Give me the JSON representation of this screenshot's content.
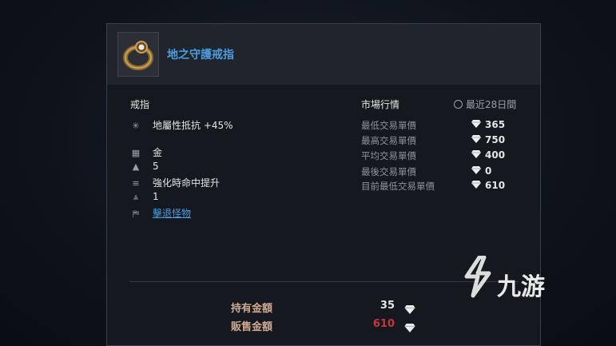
{
  "item": {
    "name": "地之守護戒指",
    "category": "戒指",
    "stats": [
      {
        "icon": "sparkle-icon",
        "text": "地屬性抵抗 +45%"
      },
      {
        "icon": "grade-icon",
        "text": "金"
      },
      {
        "icon": "level-icon",
        "text": "5"
      },
      {
        "icon": "list-icon",
        "text": "強化時命中提升"
      },
      {
        "icon": "tier-icon",
        "text": "1"
      }
    ],
    "source_link": "擊退怪物"
  },
  "market": {
    "title": "市場行情",
    "period": "最近28日間",
    "rows": [
      {
        "label": "最低交易單價",
        "value": "365"
      },
      {
        "label": "最高交易單價",
        "value": "750"
      },
      {
        "label": "平均交易單價",
        "value": "400"
      },
      {
        "label": "最後交易單價",
        "value": "0"
      },
      {
        "label": "目前最低交易單價",
        "value": "610"
      }
    ]
  },
  "footer": {
    "held_label": "持有金額",
    "held_value": "35",
    "sell_label": "販售金額",
    "sell_value": "610"
  },
  "watermark": {
    "text": "九游"
  },
  "colors": {
    "accent": "#4a9de0",
    "sell": "#c8343a"
  }
}
